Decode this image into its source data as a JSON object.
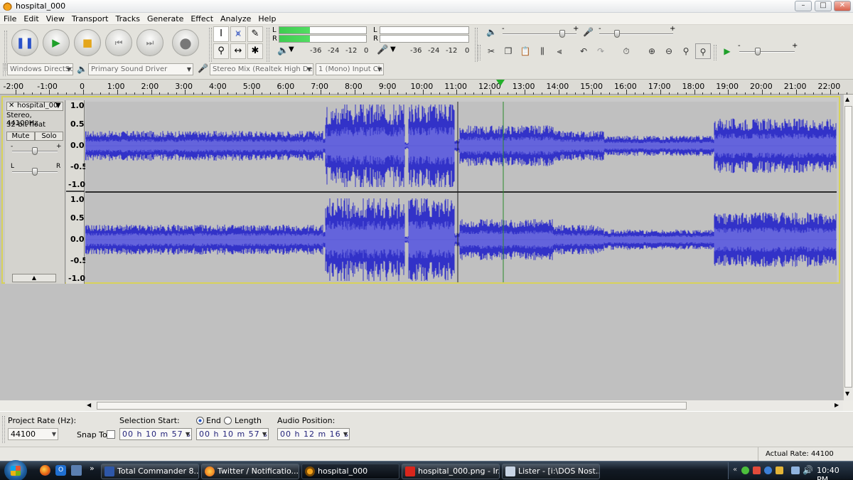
{
  "window": {
    "title": "hospital_000",
    "minimize": "–",
    "maximize": "□",
    "close": "✕"
  },
  "menu": [
    "File",
    "Edit",
    "View",
    "Transport",
    "Tracks",
    "Generate",
    "Effect",
    "Analyze",
    "Help"
  ],
  "meters": {
    "left": "L",
    "right": "R",
    "scale": [
      "-36",
      "-24",
      "-12",
      "0"
    ],
    "play_level": 0.35
  },
  "mixer": {
    "slider_min": "-",
    "slider_max": "+"
  },
  "devices": {
    "host": "Windows DirectSc",
    "playback": "Primary Sound Driver",
    "recording": "Stereo Mix (Realtek High Defin",
    "channels": "1 (Mono) Input Ch"
  },
  "ruler": {
    "labels": [
      "-2:00",
      "-1:00",
      "0",
      "1:00",
      "2:00",
      "3:00",
      "4:00",
      "5:00",
      "6:00",
      "7:00",
      "8:00",
      "9:00",
      "10:00",
      "11:00",
      "12:00",
      "13:00",
      "14:00",
      "15:00",
      "16:00",
      "17:00",
      "18:00",
      "19:00",
      "20:00",
      "21:00",
      "22:00"
    ]
  },
  "track": {
    "name": "hospital_00",
    "info1": "Stereo, 44100Hz",
    "info2": "32-bit float",
    "mute": "Mute",
    "solo": "Solo",
    "gain_min": "-",
    "gain_max": "+",
    "pan_left": "L",
    "pan_right": "R",
    "collapse": "▲",
    "amplitude_labels": [
      "1.0",
      "0.5",
      "0.0",
      "-0.5",
      "-1.0"
    ]
  },
  "selection": {
    "project_rate_label": "Project Rate (Hz):",
    "project_rate": "44100",
    "snap_to": "Snap To",
    "selection_start_label": "Selection Start:",
    "end_label": "End",
    "length_label": "Length",
    "audio_position_label": "Audio Position:",
    "start_time": "00 h 10 m 57 s",
    "end_time": "00 h 10 m 57 s",
    "audio_position": "00 h 12 m 16 s"
  },
  "status": {
    "actual_rate": "Actual Rate: 44100"
  },
  "taskbar": {
    "tasks": [
      "Total Commander 8...",
      "Twitter / Notificatio...",
      "hospital_000",
      "hospital_000.png - Ir...",
      "Lister - [i:\\DOS Nost..."
    ],
    "clock": "10:40 PM",
    "more": "»"
  }
}
